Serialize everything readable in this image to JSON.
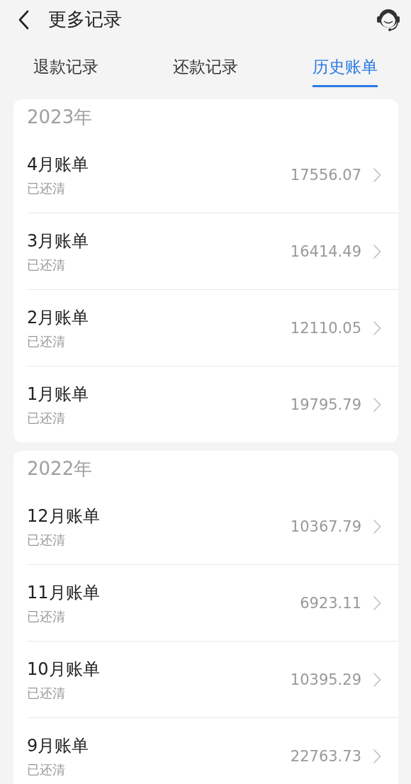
{
  "header": {
    "title": "更多记录"
  },
  "tabs": [
    {
      "label": "退款记录",
      "selected": false
    },
    {
      "label": "还款记录",
      "selected": false
    },
    {
      "label": "历史账单",
      "selected": true
    }
  ],
  "groups": [
    {
      "year": "2023年",
      "bills": [
        {
          "title": "4月账单",
          "status": "已还清",
          "amount": "17556.07"
        },
        {
          "title": "3月账单",
          "status": "已还清",
          "amount": "16414.49"
        },
        {
          "title": "2月账单",
          "status": "已还清",
          "amount": "12110.05"
        },
        {
          "title": "1月账单",
          "status": "已还清",
          "amount": "19795.79"
        }
      ]
    },
    {
      "year": "2022年",
      "bills": [
        {
          "title": "12月账单",
          "status": "已还清",
          "amount": "10367.79"
        },
        {
          "title": "11月账单",
          "status": "已还清",
          "amount": "6923.11"
        },
        {
          "title": "10月账单",
          "status": "已还清",
          "amount": "10395.29"
        },
        {
          "title": "9月账单",
          "status": "已还清",
          "amount": "22763.73"
        }
      ]
    }
  ]
}
